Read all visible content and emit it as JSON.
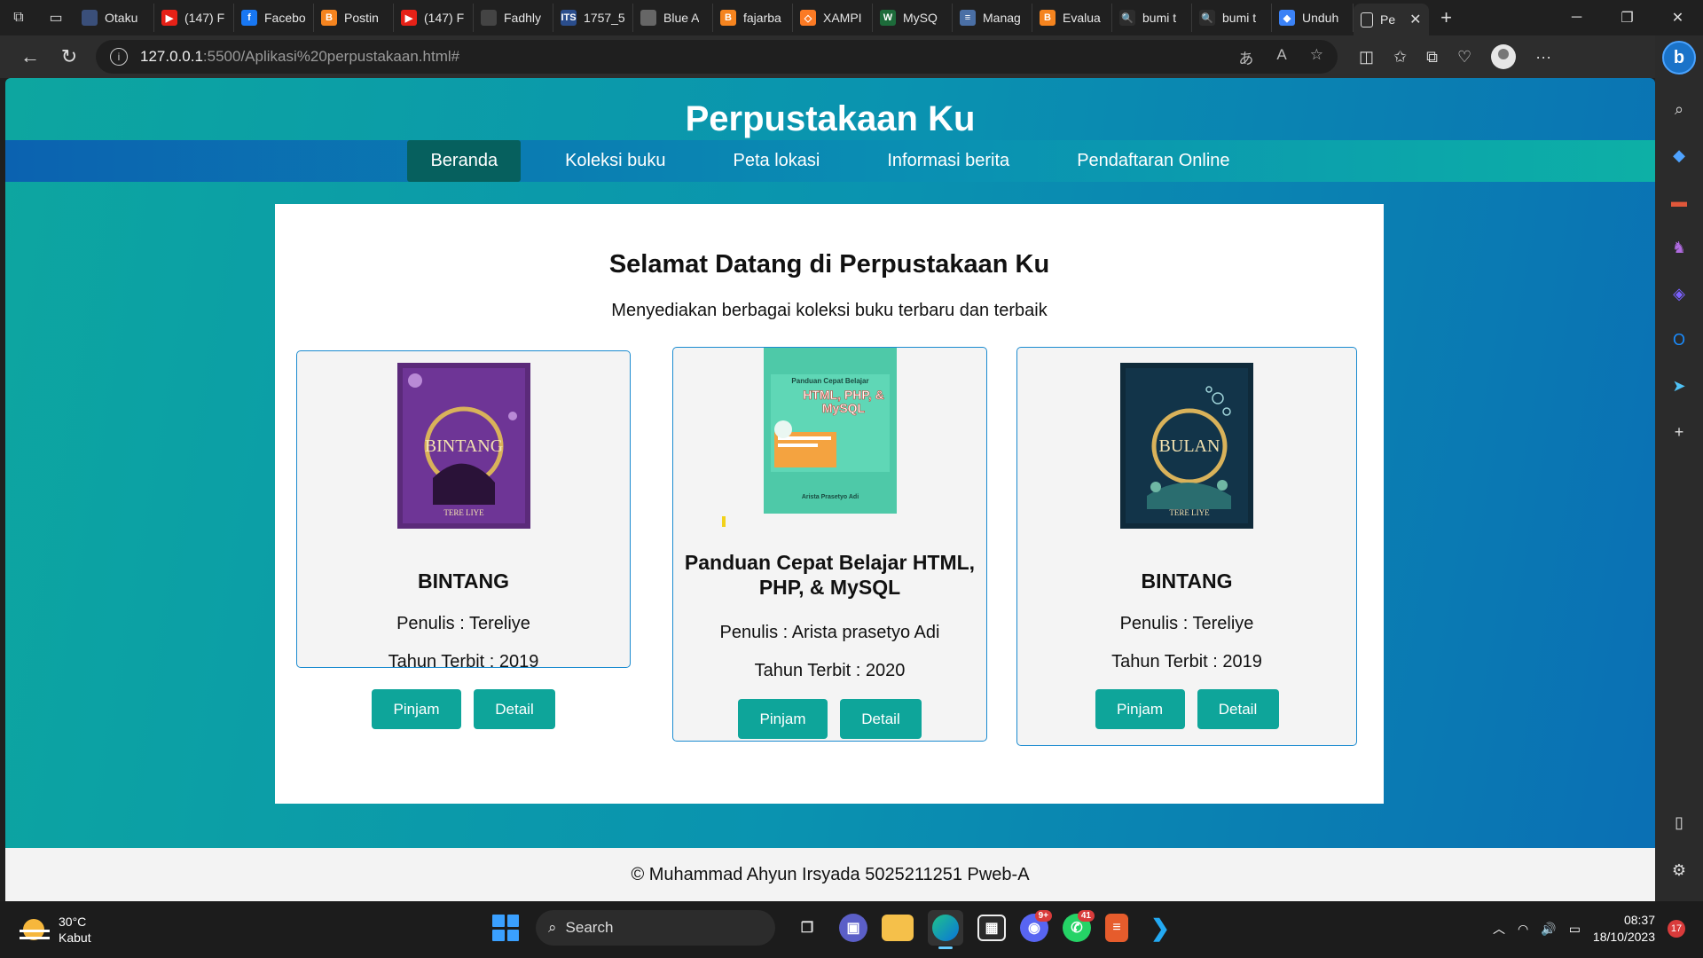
{
  "browser": {
    "tabs": [
      {
        "title": "Otaku",
        "color": "#3a4f7a",
        "glyph": ""
      },
      {
        "title": "(147) F",
        "color": "#e62117",
        "glyph": "▶"
      },
      {
        "title": "Facebo",
        "color": "#1877f2",
        "glyph": "f"
      },
      {
        "title": "Postin",
        "color": "#f5841f",
        "glyph": "B"
      },
      {
        "title": "(147) F",
        "color": "#e62117",
        "glyph": "▶"
      },
      {
        "title": "Fadhly",
        "color": "#444444",
        "glyph": ""
      },
      {
        "title": "1757_5",
        "color": "#2a4d8c",
        "glyph": "ITS"
      },
      {
        "title": "Blue A",
        "color": "#666666",
        "glyph": ""
      },
      {
        "title": "fajarba",
        "color": "#f5841f",
        "glyph": "B"
      },
      {
        "title": "XAMPI",
        "color": "#fb7a24",
        "glyph": "◇"
      },
      {
        "title": "MySQ",
        "color": "#1d6b3a",
        "glyph": "W"
      },
      {
        "title": "Manag",
        "color": "#4a6fa5",
        "glyph": "≡"
      },
      {
        "title": "Evalua",
        "color": "#f5841f",
        "glyph": "B"
      },
      {
        "title": "bumi t",
        "color": "#2d2d2d",
        "glyph": "🔍"
      },
      {
        "title": "bumi t",
        "color": "#2d2d2d",
        "glyph": "🔍"
      },
      {
        "title": "Unduh",
        "color": "#3b82f6",
        "glyph": "◆"
      }
    ],
    "active_tab": {
      "title": "Pe"
    },
    "url_host": "127.0.0.1",
    "url_path": ":5500/Aplikasi%20perpustakaan.html#"
  },
  "page": {
    "title": "Perpustakaan Ku",
    "nav": [
      {
        "label": "Beranda",
        "active": true
      },
      {
        "label": "Koleksi buku",
        "active": false
      },
      {
        "label": "Peta lokasi",
        "active": false
      },
      {
        "label": "Informasi berita",
        "active": false
      },
      {
        "label": "Pendaftaran Online",
        "active": false
      }
    ],
    "welcome": "Selamat Datang di Perpustakaan Ku",
    "tagline": "Menyediakan berbagai koleksi buku terbaru dan terbaik",
    "books": [
      {
        "title": "BINTANG",
        "author": "Penulis : Tereliye",
        "year": "Tahun Terbit : 2019",
        "cover_text": "BINTANG",
        "cover_sub": "TERE LIYE",
        "borrow": "Pinjam",
        "detail": "Detail"
      },
      {
        "title": "Panduan Cepat Belajar HTML, PHP, & MySQL",
        "author": "Penulis : Arista prasetyo Adi",
        "year": "Tahun Terbit : 2020",
        "cover_text": "HTML, PHP, & MySQL",
        "cover_top": "Panduan Cepat Belajar",
        "cover_sub": "Arista Prasetyo Adi",
        "borrow": "Pinjam",
        "detail": "Detail"
      },
      {
        "title": "BINTANG",
        "author": "Penulis : Tereliye",
        "year": "Tahun Terbit : 2019",
        "cover_text": "BULAN",
        "cover_sub": "TERE LIYE",
        "borrow": "Pinjam",
        "detail": "Detail"
      }
    ],
    "footer": "© Muhammad Ahyun Irsyada 5025211251 Pweb-A"
  },
  "taskbar": {
    "weather_temp": "30°C",
    "weather_desc": "Kabut",
    "search_label": "Search",
    "discord_badge": "9+",
    "whatsapp_badge": "41",
    "time": "08:37",
    "date": "18/10/2023",
    "notifications": "17"
  }
}
